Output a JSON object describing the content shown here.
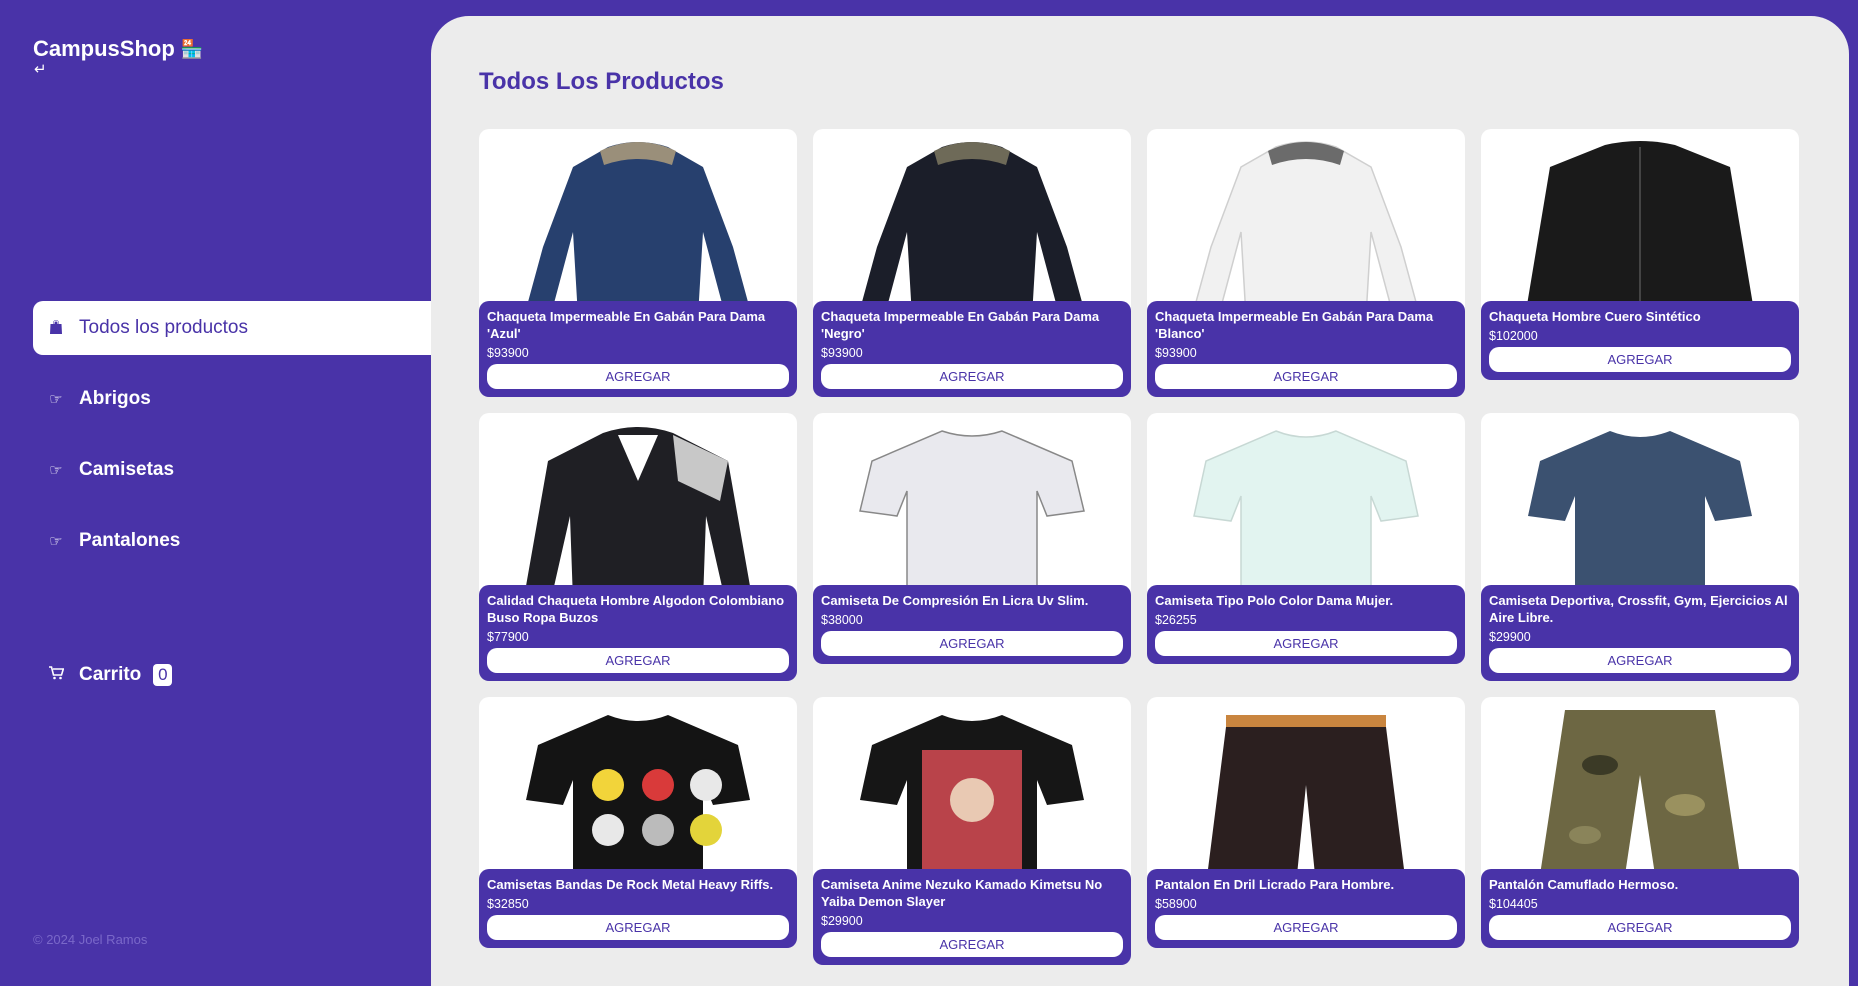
{
  "sidebar": {
    "brand": "CampusShop",
    "brand_icon": "store-icon",
    "back_icon": "return-icon",
    "nav": [
      {
        "label": "Todos los productos",
        "icon": "bag-icon",
        "active": true
      },
      {
        "label": "Abrigos",
        "icon": "pointing-hand-icon"
      },
      {
        "label": "Camisetas",
        "icon": "pointing-hand-icon"
      },
      {
        "label": "Pantalones",
        "icon": "pointing-hand-icon"
      }
    ],
    "cart": {
      "label": "Carrito",
      "count": "0",
      "icon": "cart-icon"
    },
    "footer": "© 2024 Joel Ramos"
  },
  "main": {
    "title": "Todos Los Productos",
    "add_label": "AGREGAR",
    "products": [
      {
        "name": "Chaqueta Impermeable En Gabán Para Dama 'Azul'",
        "price": "$93900",
        "color": "#27406e"
      },
      {
        "name": "Chaqueta Impermeable En Gabán Para Dama 'Negro'",
        "price": "$93900",
        "color": "#1b1e29"
      },
      {
        "name": "Chaqueta Impermeable En Gabán Para Dama 'Blanco'",
        "price": "$93900",
        "color": "#f1f1f1"
      },
      {
        "name": "Chaqueta Hombre Cuero Sintético",
        "price": "$102000",
        "color": "#1a1a1a"
      },
      {
        "name": "Calidad Chaqueta Hombre Algodon Colombiano Buso Ropa Buzos",
        "price": "$77900",
        "color": "#1f1f24"
      },
      {
        "name": "Camiseta De Compresión En Licra Uv Slim.",
        "price": "$38000",
        "color": "#e9e9ee"
      },
      {
        "name": "Camiseta Tipo Polo Color Dama Mujer.",
        "price": "$26255",
        "color": "#e2f4f0"
      },
      {
        "name": "Camiseta Deportiva, Crossfit, Gym, Ejercicios Al Aire Libre.",
        "price": "$29900",
        "color": "#3b5170"
      },
      {
        "name": "Camisetas Bandas De Rock Metal Heavy Riffs.",
        "price": "$32850",
        "color": "#141414"
      },
      {
        "name": "Camiseta Anime Nezuko Kamado Kimetsu No Yaiba Demon Slayer",
        "price": "$29900",
        "color": "#161616"
      },
      {
        "name": "Pantalon En Dril Licrado Para Hombre.",
        "price": "$58900",
        "color": "#2b1f1f"
      },
      {
        "name": "Pantalón Camuflado Hermoso.",
        "price": "$104405",
        "color": "#6d6743"
      }
    ]
  }
}
